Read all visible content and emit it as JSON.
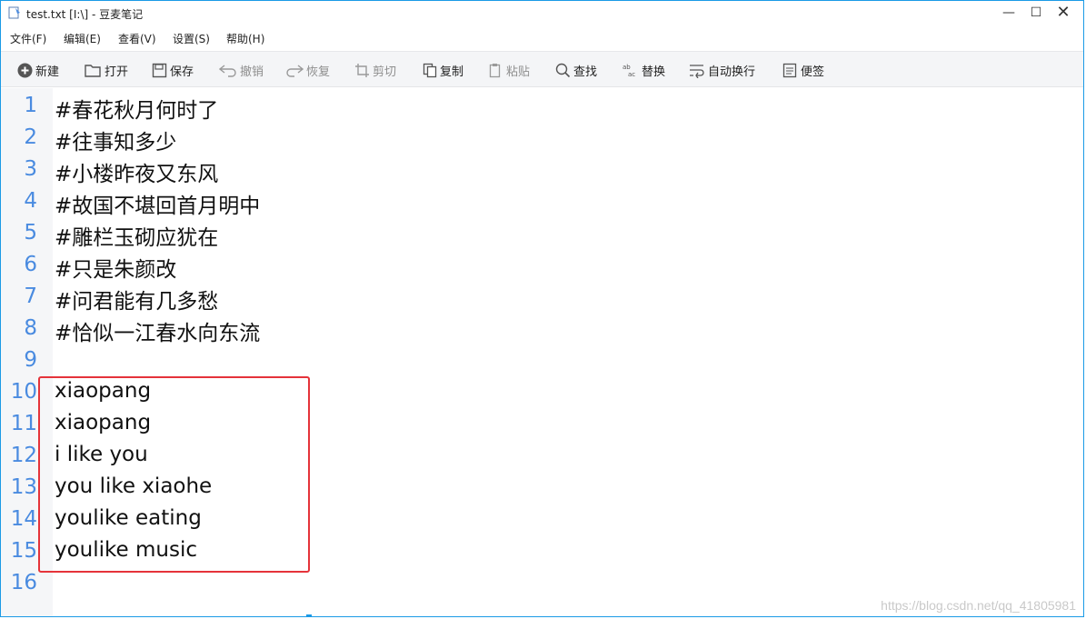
{
  "window": {
    "title": "test.txt [I:\\] - 豆麦笔记",
    "controls": {
      "minimize": "—",
      "maximize": "☐",
      "close": "✕"
    }
  },
  "menubar": [
    {
      "label": "文件(F)"
    },
    {
      "label": "编辑(E)"
    },
    {
      "label": "查看(V)"
    },
    {
      "label": "设置(S)"
    },
    {
      "label": "帮助(H)"
    }
  ],
  "toolbar": [
    {
      "label": "新建",
      "icon": "plus-circle-icon",
      "enabled": true
    },
    {
      "label": "打开",
      "icon": "open-folder-icon",
      "enabled": true
    },
    {
      "label": "保存",
      "icon": "save-icon",
      "enabled": true
    },
    {
      "label": "撤销",
      "icon": "undo-icon",
      "enabled": false
    },
    {
      "label": "恢复",
      "icon": "redo-icon",
      "enabled": false
    },
    {
      "label": "剪切",
      "icon": "cut-icon",
      "enabled": false
    },
    {
      "label": "复制",
      "icon": "copy-icon",
      "enabled": true
    },
    {
      "label": "粘贴",
      "icon": "paste-icon",
      "enabled": false
    },
    {
      "label": "查找",
      "icon": "search-icon",
      "enabled": true
    },
    {
      "label": "替换",
      "icon": "replace-icon",
      "enabled": true
    },
    {
      "label": "自动换行",
      "icon": "wrap-icon",
      "enabled": true
    },
    {
      "label": "便签",
      "icon": "note-icon",
      "enabled": true
    }
  ],
  "editor": {
    "lines": [
      {
        "n": "1",
        "text": "#春花秋月何时了"
      },
      {
        "n": "2",
        "text": "#往事知多少"
      },
      {
        "n": "3",
        "text": "#小楼昨夜又东风"
      },
      {
        "n": "4",
        "text": "#故国不堪回首月明中"
      },
      {
        "n": "5",
        "text": "#雕栏玉砌应犹在"
      },
      {
        "n": "6",
        "text": "#只是朱颜改"
      },
      {
        "n": "7",
        "text": "#问君能有几多愁"
      },
      {
        "n": "8",
        "text": "#恰似一江春水向东流"
      },
      {
        "n": "9",
        "text": ""
      },
      {
        "n": "10",
        "text": "xiaopang"
      },
      {
        "n": "11",
        "text": "xiaopang"
      },
      {
        "n": "12",
        "text": "i like you"
      },
      {
        "n": "13",
        "text": "you like xiaohe"
      },
      {
        "n": "14",
        "text": "youlike eating"
      },
      {
        "n": "15",
        "text": "youlike music"
      },
      {
        "n": "16",
        "text": ""
      }
    ]
  },
  "watermark": "https://blog.csdn.net/qq_41805981",
  "colors": {
    "accent": "#1b9ae6",
    "line_number": "#4a8be0",
    "highlight_box": "#e5333a",
    "disabled_text": "#8e8e8e"
  }
}
